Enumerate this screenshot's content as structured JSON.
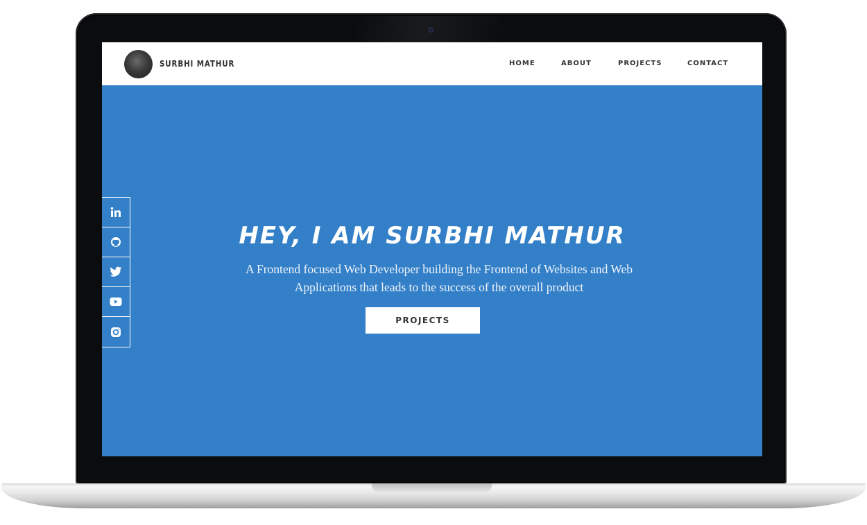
{
  "site": {
    "brand": "SURBHI MATHUR",
    "nav": [
      "HOME",
      "ABOUT",
      "PROJECTS",
      "CONTACT"
    ]
  },
  "social": [
    {
      "icon": "linkedin-icon"
    },
    {
      "icon": "github-icon"
    },
    {
      "icon": "twitter-icon"
    },
    {
      "icon": "youtube-icon"
    },
    {
      "icon": "instagram-icon"
    }
  ],
  "hero": {
    "title": "HEY, I AM SURBHI MATHUR",
    "subtitle_line1": "A Frontend focused Web Developer building the Frontend of Websites and Web",
    "subtitle_line2": "Applications that leads to the success of the overall product",
    "button_label": "PROJECTS"
  },
  "colors": {
    "hero_background": "#3480c8",
    "navbar_background": "#ffffff",
    "laptop_bezel": "#0b0c0e"
  }
}
